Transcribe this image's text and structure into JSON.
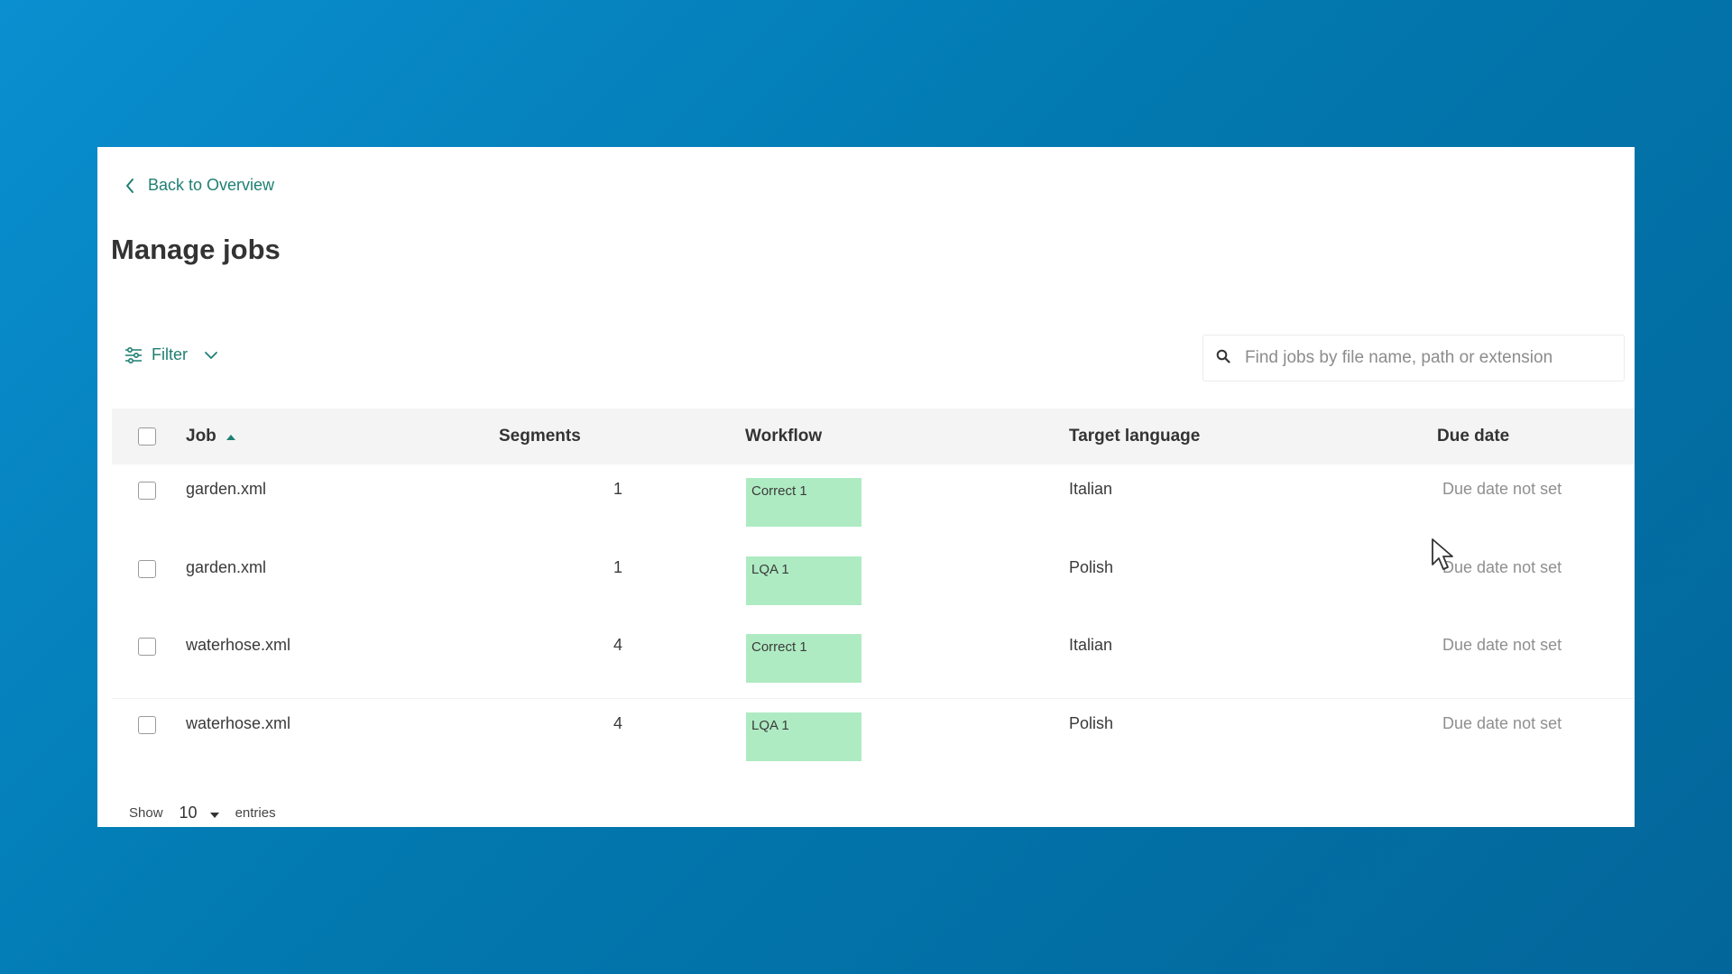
{
  "nav": {
    "back_label": "Back to Overview"
  },
  "page": {
    "title": "Manage jobs"
  },
  "toolbar": {
    "filter_label": "Filter",
    "search_placeholder": "Find jobs by file name, path or extension",
    "search_value": ""
  },
  "table": {
    "columns": {
      "job": "Job",
      "segments": "Segments",
      "workflow": "Workflow",
      "target_language": "Target language",
      "due_date": "Due date"
    },
    "sort": {
      "column": "Job",
      "direction": "ascending"
    },
    "rows": [
      {
        "job": "garden.xml",
        "segments": "1",
        "workflow": "Correct 1",
        "target_language": "Italian",
        "due_date": "Due date not set",
        "checked": false
      },
      {
        "job": "garden.xml",
        "segments": "1",
        "workflow": "LQA 1",
        "target_language": "Polish",
        "due_date": "Due date not set",
        "checked": false
      },
      {
        "job": "waterhose.xml",
        "segments": "4",
        "workflow": "Correct 1",
        "target_language": "Italian",
        "due_date": "Due date not set",
        "checked": false
      },
      {
        "job": "waterhose.xml",
        "segments": "4",
        "workflow": "LQA 1",
        "target_language": "Polish",
        "due_date": "Due date not set",
        "checked": false
      }
    ]
  },
  "pagination": {
    "show_label": "Show",
    "page_size": "10",
    "entries_label": "entries"
  },
  "colors": {
    "background_gradient_start": "#0a8fd0",
    "background_gradient_end": "#03669a",
    "accent_teal": "#1f7f72",
    "workflow_badge": "#aeebc2",
    "header_row_bg": "#f4f4f4"
  },
  "icons": [
    "chevron-left-icon",
    "filter-sliders-icon",
    "chevron-down-icon",
    "search-icon",
    "sort-up-icon",
    "caret-down-icon",
    "mouse-cursor-icon"
  ]
}
